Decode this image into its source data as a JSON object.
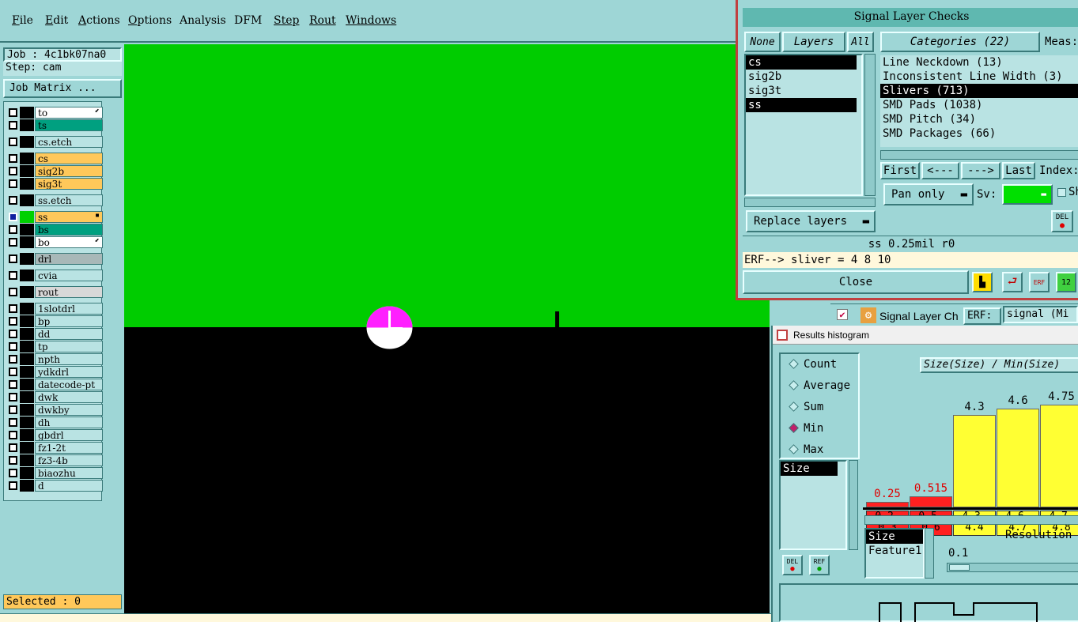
{
  "menubar": {
    "items": [
      {
        "first": "F",
        "rest": "ile"
      },
      {
        "first": "E",
        "rest": "dit"
      },
      {
        "first": "A",
        "rest": "ctions"
      },
      {
        "first": "O",
        "rest": "ptions"
      },
      {
        "first": "A",
        "rest": "nalysis"
      },
      {
        "first": "D",
        "rest": "FM"
      },
      {
        "first": "S",
        "rest": "tep"
      },
      {
        "first": "R",
        "rest": "out"
      },
      {
        "first": "W",
        "rest": "indows"
      }
    ]
  },
  "left_panel": {
    "job": "Job : 4c1bk07na0",
    "step": "Step: cam",
    "job_matrix": "Job Matrix ...",
    "selected": "Selected : 0",
    "layers": [
      {
        "name": "to",
        "color": "#ffffff",
        "mark": "⬋"
      },
      {
        "name": "ts",
        "color": "#00a080",
        "mark": ""
      },
      {
        "name": "cs.etch",
        "color": "#b9e3e3",
        "mark": ""
      },
      {
        "name": "cs",
        "color": "#ffc85a",
        "mark": ""
      },
      {
        "name": "sig2b",
        "color": "#ffc85a",
        "mark": ""
      },
      {
        "name": "sig3t",
        "color": "#ffc85a",
        "mark": ""
      },
      {
        "name": "ss.etch",
        "color": "#b9e3e3",
        "mark": ""
      },
      {
        "name": "ss",
        "color": "#ffc85a",
        "mark": "▪"
      },
      {
        "name": "bs",
        "color": "#00a080",
        "mark": ""
      },
      {
        "name": "bo",
        "color": "#ffffff",
        "mark": "⬋"
      },
      {
        "name": "drl",
        "color": "#a8b8b8",
        "mark": ""
      },
      {
        "name": "cvia",
        "color": "#b9e3e3",
        "mark": ""
      },
      {
        "name": "rout",
        "color": "#d8d8d8",
        "mark": ""
      },
      {
        "name": "1slotdrl",
        "color": "#b9e3e3",
        "mark": ""
      },
      {
        "name": "bp",
        "color": "#b9e3e3",
        "mark": ""
      },
      {
        "name": "dd",
        "color": "#b9e3e3",
        "mark": ""
      },
      {
        "name": "tp",
        "color": "#b9e3e3",
        "mark": ""
      },
      {
        "name": "npth",
        "color": "#b9e3e3",
        "mark": ""
      },
      {
        "name": "ydkdrl",
        "color": "#b9e3e3",
        "mark": ""
      },
      {
        "name": "datecode-pt",
        "color": "#b9e3e3",
        "mark": ""
      },
      {
        "name": "dwk",
        "color": "#b9e3e3",
        "mark": ""
      },
      {
        "name": "dwkby",
        "color": "#b9e3e3",
        "mark": ""
      },
      {
        "name": "dh",
        "color": "#b9e3e3",
        "mark": ""
      },
      {
        "name": "gbdrl",
        "color": "#b9e3e3",
        "mark": ""
      },
      {
        "name": "fz1-2t",
        "color": "#b9e3e3",
        "mark": ""
      },
      {
        "name": "fz3-4b",
        "color": "#b9e3e3",
        "mark": ""
      },
      {
        "name": "biaozhu",
        "color": "#b9e3e3",
        "mark": ""
      },
      {
        "name": "d",
        "color": "#b9e3e3",
        "mark": ""
      }
    ]
  },
  "signal_checks": {
    "title": "Signal Layer Checks",
    "none_btn": "None",
    "layers_btn": "Layers",
    "all_btn": "All",
    "layer_items": [
      "cs",
      "sig2b",
      "sig3t",
      "ss"
    ],
    "categories_label": "Categories (22)",
    "meas_label": "Meas:",
    "categories": [
      "Line Neckdown (13)",
      "Inconsistent Line Width (3)",
      "Slivers (713)",
      "SMD Pads (1038)",
      "SMD Pitch (34)",
      "SMD Packages (66)"
    ],
    "first_btn": "First",
    "prev_btn": "<---",
    "next_btn": "--->",
    "last_btn": "Last",
    "index_label": "Index:",
    "pan_option": "Pan only",
    "sv_label": "Sv:",
    "sh_label": "Sh",
    "replace_layers": "Replace layers",
    "del_label": "DEL",
    "status": "ss 0.25mil  r0",
    "erf_line": "ERF--> sliver = 4 8 10",
    "close_btn": "Close",
    "erf_icon": "ERF",
    "num_icon": "12"
  },
  "sub_bar": {
    "title": "Signal Layer Ch",
    "erf_label": "ERF:",
    "erf_value": "signal (Mi"
  },
  "histogram": {
    "title": "Results histogram",
    "modes": [
      "Count",
      "Average",
      "Sum",
      "Min",
      "Max"
    ],
    "selected_mode": "Min",
    "chart_title": "Size(Size) / Min(Size)",
    "list1": [
      "Size"
    ],
    "list2": [
      "Size",
      "Feature1"
    ],
    "resolution_label": "Resolution",
    "resolution_value": "0.1",
    "del_label": "DEL",
    "ref_label": "REF"
  },
  "chart_data": {
    "type": "bar",
    "title": "Size(Size) / Min(Size)",
    "categories": [
      "0.2-0.3",
      "0.5-0.6",
      "4.3-4.4",
      "4.6-4.7",
      "4.7-4.8"
    ],
    "values": [
      0.25,
      0.515,
      4.3,
      4.6,
      4.75
    ],
    "value_labels": [
      "0.25",
      "0.515",
      "4.3",
      "4.6",
      "4.75"
    ],
    "range_tops": [
      "0.2-",
      "0.5-",
      "4.3-",
      "4.6-",
      "4.7-"
    ],
    "range_bottoms": [
      "0.3",
      "0.6",
      "4.4",
      "4.7",
      "4.8"
    ],
    "colors": [
      "#ff2020",
      "#ff2020",
      "#ffff33",
      "#ffff33",
      "#ffff33"
    ],
    "ylim": [
      0,
      5.5
    ]
  },
  "canvas": {
    "green": "#00cc00",
    "pad_color": "#ff20ff"
  }
}
